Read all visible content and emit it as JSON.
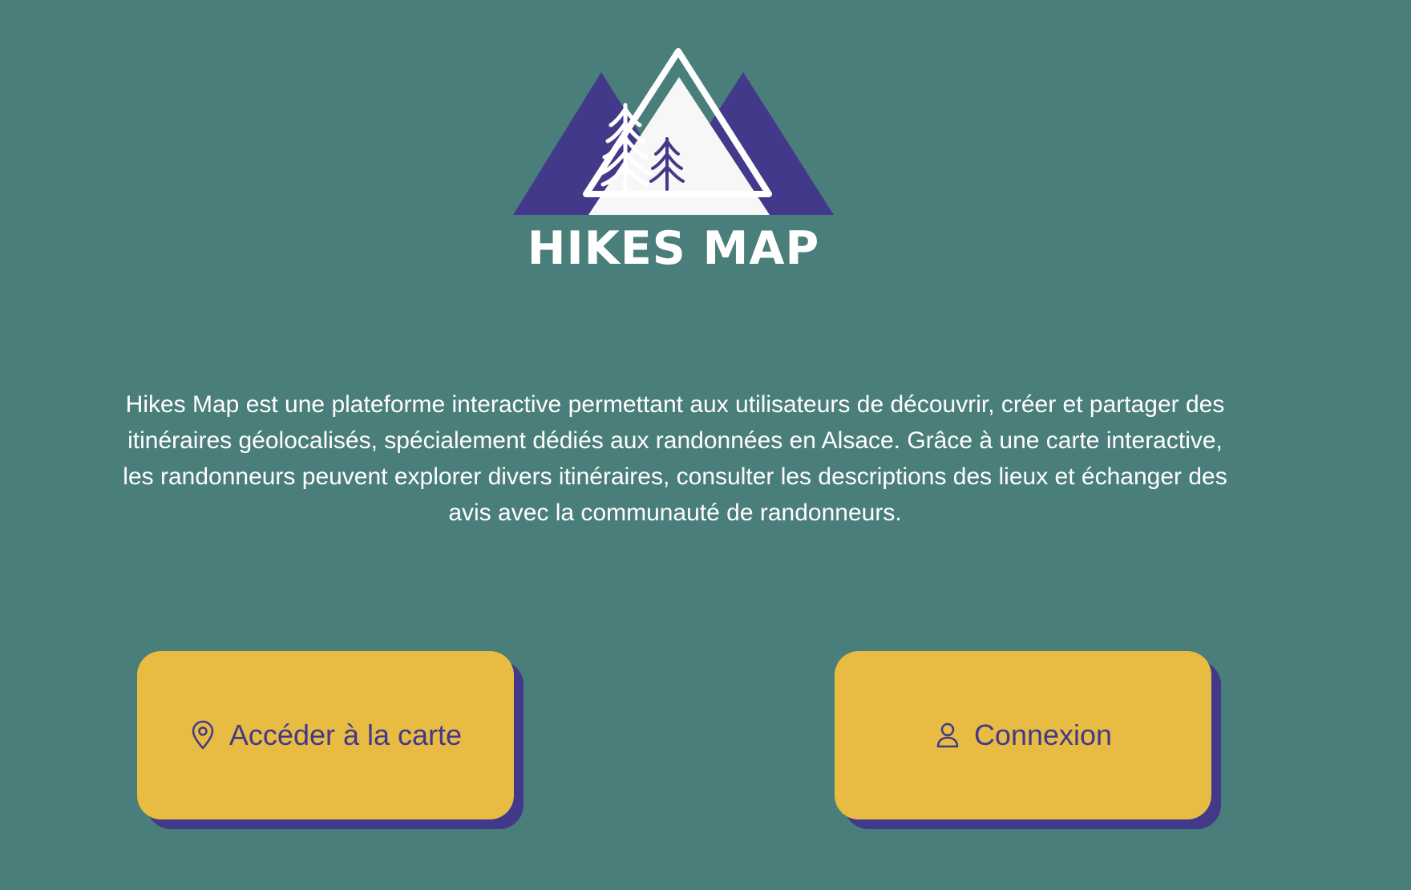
{
  "brand": {
    "name": "HIKES MAP",
    "colors": {
      "background": "#4a7e7b",
      "mountain_dark": "#43398a",
      "mountain_light": "#f7f7f7",
      "button": "#e8bb43",
      "button_shadow": "#43398a",
      "text": "#ffffff"
    }
  },
  "intro": {
    "description": "Hikes Map est une plateforme interactive permettant aux utilisateurs de découvrir, créer et partager des itinéraires géolocalisés, spécialement dédiés aux randonnées en Alsace. Grâce à une carte interactive, les randonneurs peuvent explorer divers itinéraires, consulter les descriptions des lieux et échanger des avis avec la communauté de randonneurs."
  },
  "actions": {
    "map_label": "Accéder à la carte",
    "map_icon": "map-pin-icon",
    "login_label": "Connexion",
    "login_icon": "user-icon"
  }
}
